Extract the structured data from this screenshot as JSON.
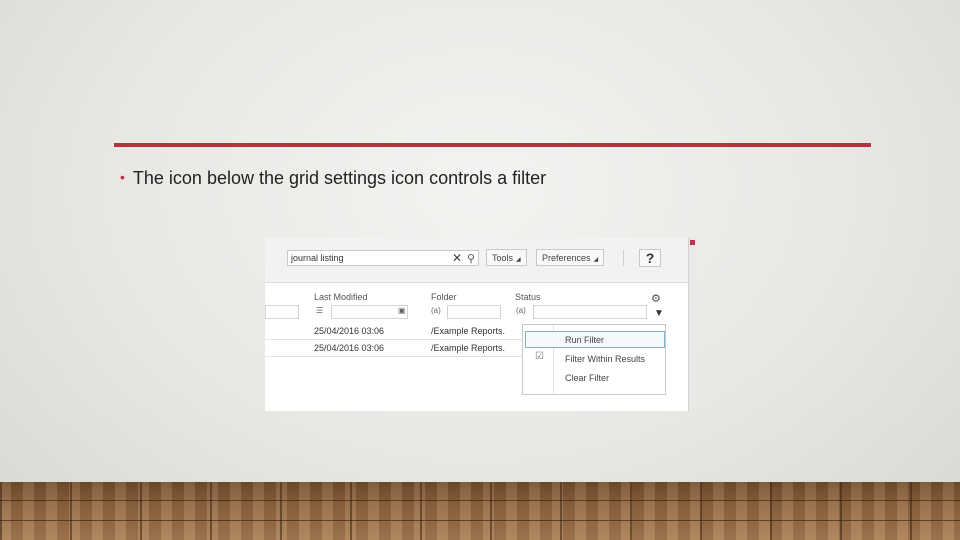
{
  "slide": {
    "bullet_text": "The icon below the grid settings icon controls a filter",
    "accent_color": "#b8313d"
  },
  "screenshot": {
    "search": {
      "value": "journal listing",
      "clear_icon": "close-icon",
      "search_icon": "search-icon"
    },
    "toolbar": {
      "tools_label": "Tools",
      "preferences_label": "Preferences",
      "help_label": "?"
    },
    "columns": [
      {
        "label": "Last Modified"
      },
      {
        "label": "Folder"
      },
      {
        "label": "Status"
      }
    ],
    "column_filter_icons": [
      "list-filter-icon",
      "calendar-icon",
      "text-filter-icon",
      "text-filter-icon"
    ],
    "folder_filter_glyph": "(a)",
    "status_filter_glyph": "(a)",
    "grid_settings_icon": "gear-icon",
    "filter_icon": "funnel-icon",
    "rows": [
      {
        "last_modified": "25/04/2016 03:06",
        "folder": "/Example Reports."
      },
      {
        "last_modified": "25/04/2016 03:06",
        "folder": "/Example Reports."
      }
    ],
    "filter_menu": {
      "items": [
        {
          "label": "Run Filter",
          "highlighted": true,
          "checked": false
        },
        {
          "label": "Filter Within Results",
          "highlighted": false,
          "checked": true
        },
        {
          "label": "Clear Filter",
          "highlighted": false,
          "checked": false
        }
      ]
    }
  }
}
